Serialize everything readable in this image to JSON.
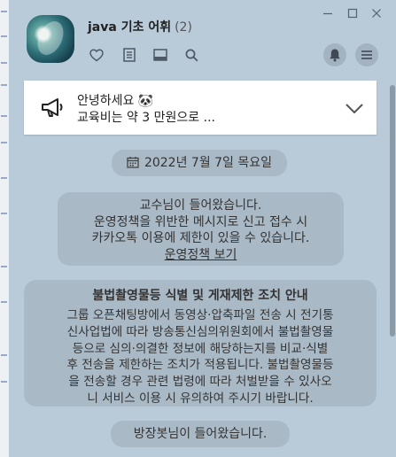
{
  "header": {
    "title": "java 기초 어휘",
    "member_count": "(2)"
  },
  "notice": {
    "line1": "안녕하세요 🐼",
    "line2": "교육비는 약 3 만원으로 ..."
  },
  "messages": {
    "date": "2022년 7월 7일 목요일",
    "system_join_professor": "교수님이 들어왔습니다.",
    "policy_line1": "운영정책을 위반한 메시지로 신고 접수 시",
    "policy_line2": "카카오톡 이용에 제한이 있을 수 있습니다.",
    "policy_link": "운영정책 보기",
    "warning_title": "불법촬영물등 식별 및 게재제한 조치 안내",
    "warning_lines": [
      "그룹 오픈채팅방에서 동영상·압축파일 전송 시 전기통",
      "신사업법에 따라 방송통신심의위원회에서 불법촬영물",
      "등으로 심의·의결한 정보에 해당하는지를 비교·식별",
      "후 전송을 제한하는 조치가 적용됩니다. 불법촬영물등",
      "을 전송할 경우 관련 법령에 따라 처벌받을 수 있사오",
      "니 서비스 이용 시 유의하여 주시기 바랍니다."
    ],
    "system_join_host": "방장봇님이 들어왔습니다."
  },
  "icons": {
    "favorite": "heart-icon",
    "notes": "notes-icon",
    "album": "album-icon",
    "search": "search-icon",
    "notifications": "bell-icon",
    "menu": "menu-icon",
    "minimize": "minimize-icon",
    "maximize": "maximize-icon",
    "close": "close-icon",
    "notice": "megaphone-icon",
    "expand": "chevron-down-icon",
    "date": "calendar-icon"
  },
  "colors": {
    "chat_background": "#b9cad8",
    "system_bubble": "#aab9c6",
    "notice_background": "#ffffff"
  }
}
